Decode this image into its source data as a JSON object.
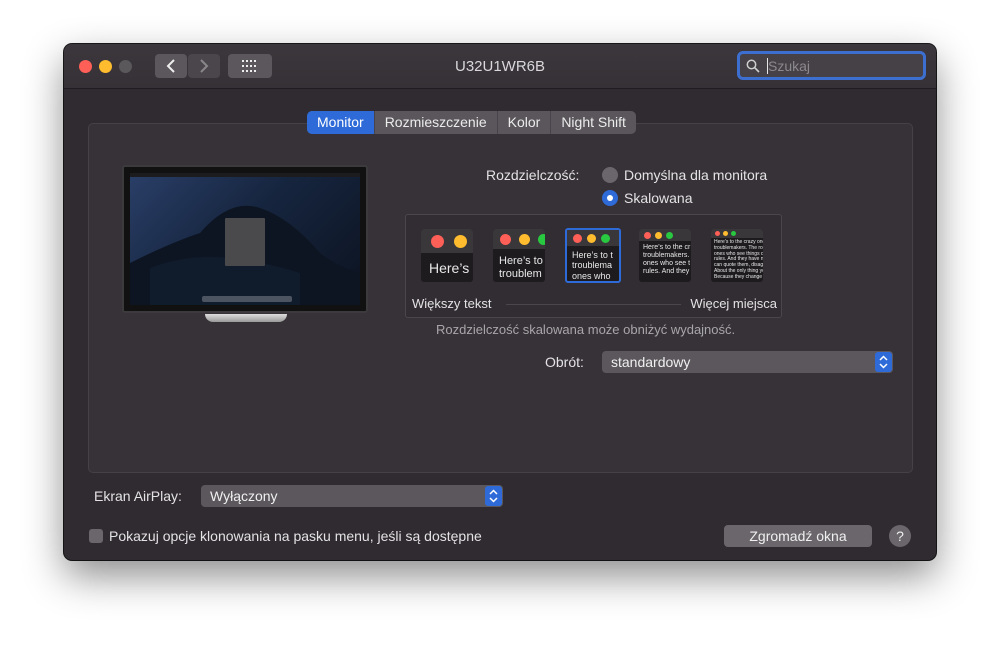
{
  "window": {
    "title": "U32U1WR6B",
    "search_placeholder": "Szukaj"
  },
  "tabs": [
    "Monitor",
    "Rozmieszczenie",
    "Kolor",
    "Night Shift"
  ],
  "resolution": {
    "label": "Rozdzielczość:",
    "options": [
      "Domyślna dla monitora",
      "Skalowana"
    ],
    "selected": "Skalowana",
    "scale_left_label": "Większy tekst",
    "scale_right_label": "Więcej miejsca",
    "warning": "Rozdzielczość skalowana może obniżyć wydajność.",
    "thumbs": [
      {
        "text": "Here’s"
      },
      {
        "text": "Here’s to\ntroublem"
      },
      {
        "text": "Here’s to t\ntroublema\nones who"
      },
      {
        "text": "Here’s to the cr\ntroublemakers.\nones who see t\nrules. And they"
      },
      {
        "text": "Here’s to the crazy one\ntroublemakers. The roun\nones who see things di\nrules. And they have no\ncan quote them, disagre\nAbout the only thing yo\nBecause they change th"
      }
    ]
  },
  "rotation": {
    "label": "Obrót:",
    "value": "standardowy"
  },
  "airplay": {
    "label": "Ekran AirPlay:",
    "value": "Wyłączony"
  },
  "mirror_checkbox": {
    "label": "Pokazuj opcje klonowania na pasku menu, jeśli są dostępne",
    "checked": false
  },
  "gather_button": "Zgromadź okna",
  "help_button": "?",
  "colors": {
    "accent": "#2e6bd8",
    "window_bg": "#2f2b30"
  }
}
